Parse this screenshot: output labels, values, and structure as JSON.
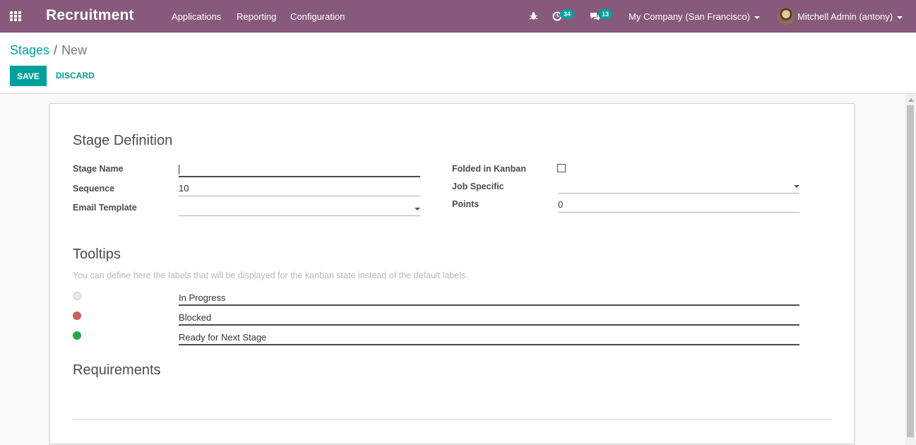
{
  "navbar": {
    "brand": "Recruitment",
    "menu": [
      "Applications",
      "Reporting",
      "Configuration"
    ],
    "activity_badge": "34",
    "messages_badge": "13",
    "company": "My Company (San Francisco)",
    "user": "Mitchell Admin (antony)",
    "bg_color": "#875a7b"
  },
  "breadcrumb": {
    "parent": "Stages",
    "separator": "/",
    "current": "New"
  },
  "buttons": {
    "save": "SAVE",
    "discard": "DISCARD",
    "accent_color": "#00a09d"
  },
  "form": {
    "stage_definition": {
      "title": "Stage Definition",
      "stage_name_label": "Stage Name",
      "stage_name_value": "",
      "sequence_label": "Sequence",
      "sequence_value": "10",
      "email_template_label": "Email Template",
      "email_template_value": "",
      "folded_label": "Folded in Kanban",
      "folded_checked": false,
      "job_specific_label": "Job Specific",
      "job_specific_value": "",
      "points_label": "Points",
      "points_value": "0"
    },
    "tooltips": {
      "title": "Tooltips",
      "hint": "You can define here the labels that will be displayed for the kanban state instead of the default labels.",
      "items": [
        {
          "state": "normal",
          "label": "In Progress",
          "color": "#e0e0e0"
        },
        {
          "state": "blocked",
          "label": "Blocked",
          "color": "#d9534f"
        },
        {
          "state": "done",
          "label": "Ready for Next Stage",
          "color": "#28a745"
        }
      ]
    },
    "requirements": {
      "title": "Requirements",
      "value": ""
    }
  }
}
